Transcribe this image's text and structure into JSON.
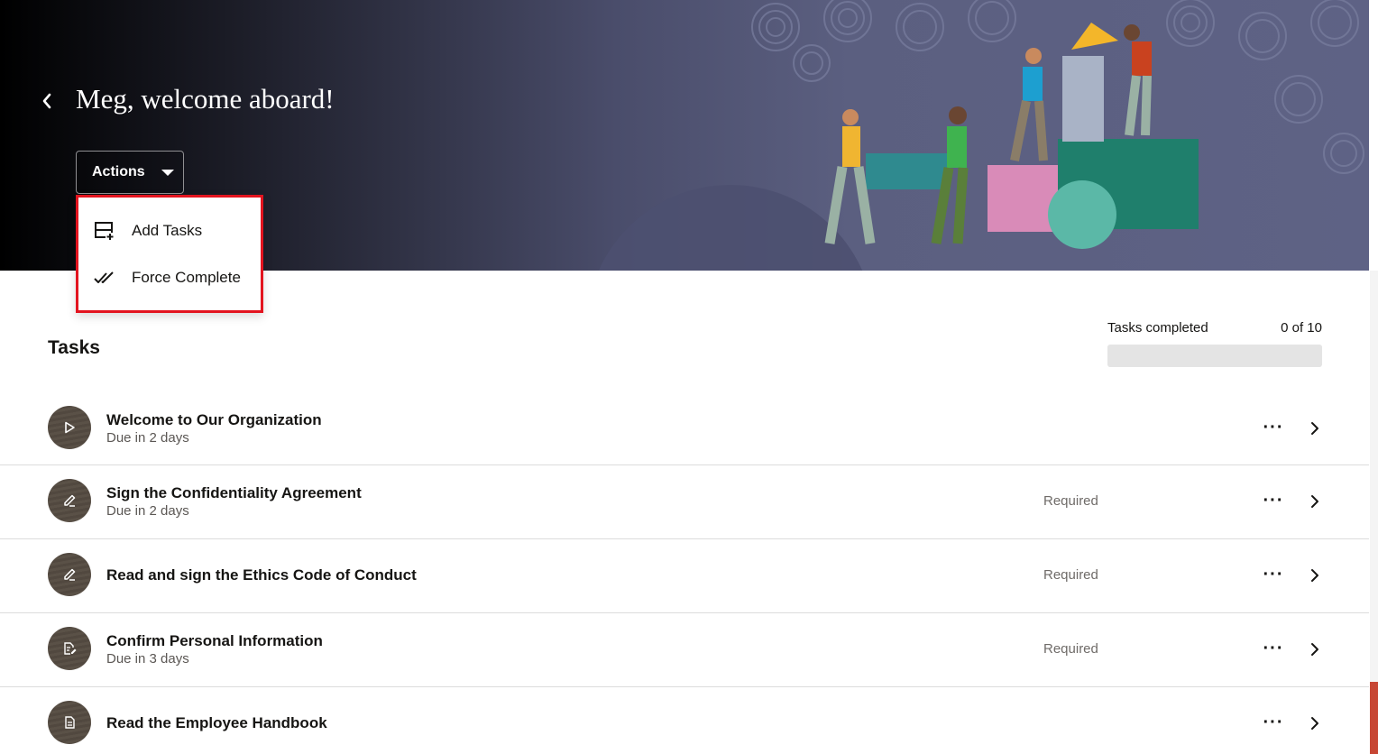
{
  "header": {
    "title": "Meg, welcome aboard!",
    "actions_label": "Actions"
  },
  "actions_menu": {
    "items": [
      {
        "label": "Add Tasks",
        "icon": "add-tasks-icon"
      },
      {
        "label": "Force Complete",
        "icon": "double-check-icon"
      }
    ]
  },
  "tasks": {
    "heading": "Tasks",
    "progress_label": "Tasks completed",
    "progress_count": "0 of 10",
    "progress_fraction": 0,
    "items": [
      {
        "title": "Welcome to Our Organization",
        "due": "Due in 2 days",
        "status": "",
        "icon": "play-icon"
      },
      {
        "title": "Sign the Confidentiality Agreement",
        "due": "Due in 2 days",
        "status": "Required",
        "icon": "pencil-icon"
      },
      {
        "title": "Read and sign the Ethics Code of Conduct",
        "due": "",
        "status": "Required",
        "icon": "pencil-icon"
      },
      {
        "title": "Confirm Personal Information",
        "due": "Due in 3 days",
        "status": "Required",
        "icon": "form-edit-icon"
      },
      {
        "title": "Read the Employee Handbook",
        "due": "",
        "status": "",
        "icon": "document-icon"
      }
    ]
  },
  "colors": {
    "menu_highlight": "#e3141f",
    "progress_track": "#e4e4e4",
    "edge_accent": "#c74634"
  }
}
